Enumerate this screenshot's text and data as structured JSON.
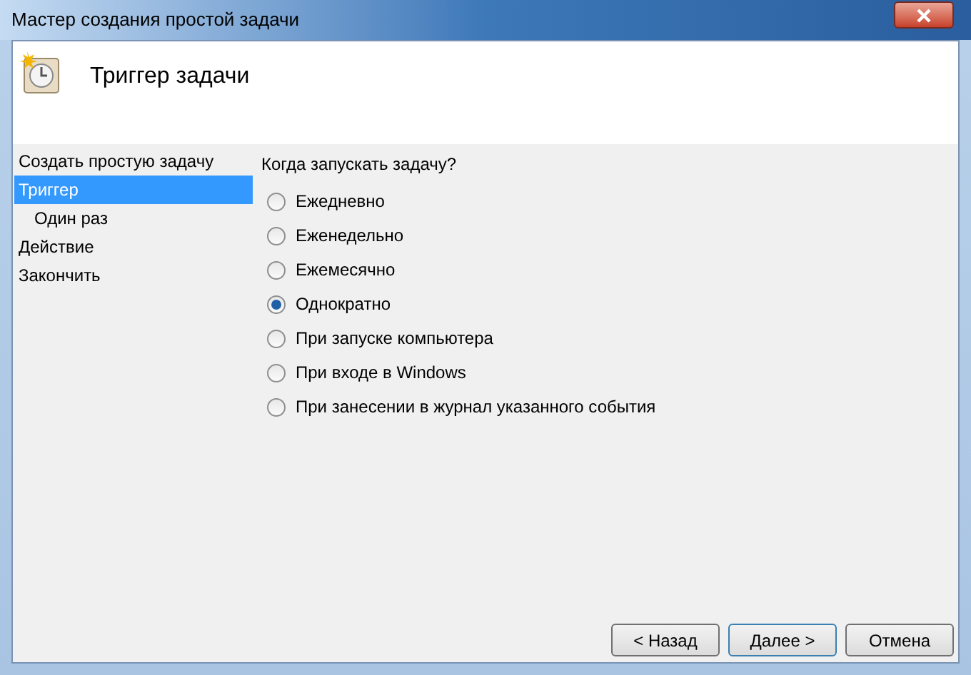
{
  "window": {
    "title": "Мастер создания простой задачи"
  },
  "header": {
    "title": "Триггер задачи"
  },
  "steps": [
    {
      "label": "Создать простую задачу",
      "selected": false
    },
    {
      "label": "Триггер",
      "selected": true,
      "children": [
        {
          "label": "Один раз",
          "selected": false
        }
      ]
    },
    {
      "label": "Действие",
      "selected": false
    },
    {
      "label": "Закончить",
      "selected": false
    }
  ],
  "question": "Когда запускать задачу?",
  "options": [
    {
      "label": "Ежедневно",
      "selected": false
    },
    {
      "label": "Еженедельно",
      "selected": false
    },
    {
      "label": "Ежемесячно",
      "selected": false
    },
    {
      "label": "Однократно",
      "selected": true
    },
    {
      "label": "При запуске компьютера",
      "selected": false
    },
    {
      "label": "При входе в Windows",
      "selected": false
    },
    {
      "label": "При занесении в журнал указанного события",
      "selected": false
    }
  ],
  "buttons": [
    {
      "label": "< Назад",
      "kind": "normal"
    },
    {
      "label": "Далее >",
      "kind": "default"
    },
    {
      "label": "Отмена",
      "kind": "normal"
    }
  ]
}
